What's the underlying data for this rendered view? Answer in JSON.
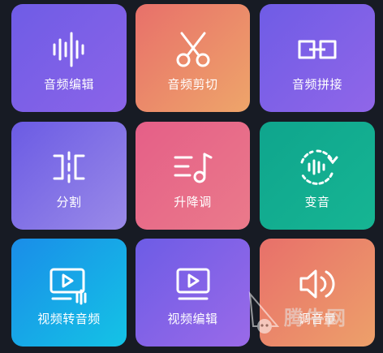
{
  "colors": {
    "background": "#171b24",
    "purple": "#7e5de6",
    "orange": "#ea8a62",
    "pink": "#e7688a",
    "teal": "#13ad8f",
    "blue": "#1a9ee8"
  },
  "tiles": [
    {
      "label": "音频编辑",
      "icon": "audio-waveform-icon"
    },
    {
      "label": "音频剪切",
      "icon": "scissors-icon"
    },
    {
      "label": "音频拼接",
      "icon": "merge-blocks-icon"
    },
    {
      "label": "分割",
      "icon": "split-icon"
    },
    {
      "label": "升降调",
      "icon": "pitch-note-icon"
    },
    {
      "label": "变音",
      "icon": "voice-change-icon"
    },
    {
      "label": "视频转音频",
      "icon": "video-to-audio-icon"
    },
    {
      "label": "视频编辑",
      "icon": "video-play-icon"
    },
    {
      "label": "调音量",
      "icon": "volume-icon"
    }
  ],
  "watermark": {
    "text": "腾牛网"
  }
}
